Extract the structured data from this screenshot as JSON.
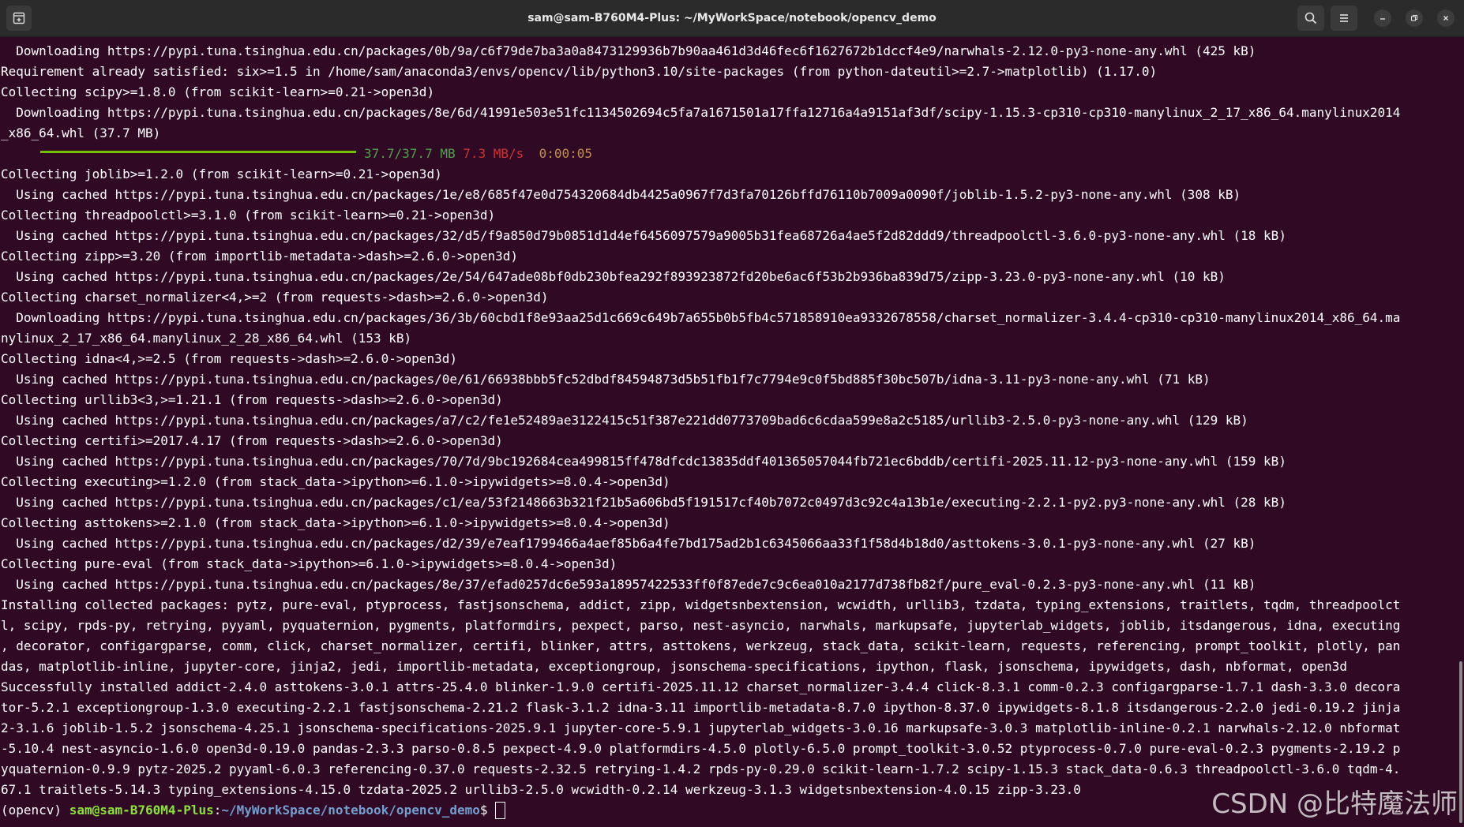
{
  "window": {
    "title": "sam@sam-B760M4-Plus: ~/MyWorkSpace/notebook/opencv_demo"
  },
  "titlebar_icons": {
    "new_tab": "new-tab-icon",
    "search": "search-icon",
    "menu": "hamburger-menu-icon",
    "minimize": "minimize-icon",
    "restore": "restore-icon",
    "close": "close-icon"
  },
  "colors": {
    "background": "#300a24",
    "text": "#ffffff",
    "progress_green": "#73c000",
    "prompt_user": "#8ae234",
    "prompt_path": "#729fcf"
  },
  "terminal": {
    "lines": [
      "  Downloading https://pypi.tuna.tsinghua.edu.cn/packages/0b/9a/c6f79de7ba3a0a8473129936b7b90aa461d3d46fec6f1627672b1dccf4e9/narwhals-2.12.0-py3-none-any.whl (425 kB)",
      "Requirement already satisfied: six>=1.5 in /home/sam/anaconda3/envs/opencv/lib/python3.10/site-packages (from python-dateutil>=2.7->matplotlib) (1.17.0)",
      "Collecting scipy>=1.8.0 (from scikit-learn>=0.21->open3d)",
      "  Downloading https://pypi.tuna.tsinghua.edu.cn/packages/8e/6d/41991e503e51fc1134502694c5fa7a1671501a17ffa12716a4a9151af3df/scipy-1.15.3-cp310-cp310-manylinux_2_17_x86_64.manylinux2014",
      "_x86_64.whl (37.7 MB)"
    ],
    "progress": {
      "done": "37.7/37.7 MB",
      "speed": "7.3 MB/s",
      "eta": "0:00:05",
      "fraction": 1.0
    },
    "lines2": [
      "Collecting joblib>=1.2.0 (from scikit-learn>=0.21->open3d)",
      "  Using cached https://pypi.tuna.tsinghua.edu.cn/packages/1e/e8/685f47e0d754320684db4425a0967f7d3fa70126bffd76110b7009a0090f/joblib-1.5.2-py3-none-any.whl (308 kB)",
      "Collecting threadpoolctl>=3.1.0 (from scikit-learn>=0.21->open3d)",
      "  Using cached https://pypi.tuna.tsinghua.edu.cn/packages/32/d5/f9a850d79b0851d1d4ef6456097579a9005b31fea68726a4ae5f2d82ddd9/threadpoolctl-3.6.0-py3-none-any.whl (18 kB)",
      "Collecting zipp>=3.20 (from importlib-metadata->dash>=2.6.0->open3d)",
      "  Using cached https://pypi.tuna.tsinghua.edu.cn/packages/2e/54/647ade08bf0db230bfea292f893923872fd20be6ac6f53b2b936ba839d75/zipp-3.23.0-py3-none-any.whl (10 kB)",
      "Collecting charset_normalizer<4,>=2 (from requests->dash>=2.6.0->open3d)",
      "  Downloading https://pypi.tuna.tsinghua.edu.cn/packages/36/3b/60cbd1f8e93aa25d1c669c649b7a655b0b5fb4c571858910ea9332678558/charset_normalizer-3.4.4-cp310-cp310-manylinux2014_x86_64.ma",
      "nylinux_2_17_x86_64.manylinux_2_28_x86_64.whl (153 kB)",
      "Collecting idna<4,>=2.5 (from requests->dash>=2.6.0->open3d)",
      "  Using cached https://pypi.tuna.tsinghua.edu.cn/packages/0e/61/66938bbb5fc52dbdf84594873d5b51fb1f7c7794e9c0f5bd885f30bc507b/idna-3.11-py3-none-any.whl (71 kB)",
      "Collecting urllib3<3,>=1.21.1 (from requests->dash>=2.6.0->open3d)",
      "  Using cached https://pypi.tuna.tsinghua.edu.cn/packages/a7/c2/fe1e52489ae3122415c51f387e221dd0773709bad6c6cdaa599e8a2c5185/urllib3-2.5.0-py3-none-any.whl (129 kB)",
      "Collecting certifi>=2017.4.17 (from requests->dash>=2.6.0->open3d)",
      "  Using cached https://pypi.tuna.tsinghua.edu.cn/packages/70/7d/9bc192684cea499815ff478dfcdc13835ddf401365057044fb721ec6bddb/certifi-2025.11.12-py3-none-any.whl (159 kB)",
      "Collecting executing>=1.2.0 (from stack_data->ipython>=6.1.0->ipywidgets>=8.0.4->open3d)",
      "  Using cached https://pypi.tuna.tsinghua.edu.cn/packages/c1/ea/53f2148663b321f21b5a606bd5f191517cf40b7072c0497d3c92c4a13b1e/executing-2.2.1-py2.py3-none-any.whl (28 kB)",
      "Collecting asttokens>=2.1.0 (from stack_data->ipython>=6.1.0->ipywidgets>=8.0.4->open3d)",
      "  Using cached https://pypi.tuna.tsinghua.edu.cn/packages/d2/39/e7eaf1799466a4aef85b6a4fe7bd175ad2b1c6345066aa33f1f58d4b18d0/asttokens-3.0.1-py3-none-any.whl (27 kB)",
      "Collecting pure-eval (from stack_data->ipython>=6.1.0->ipywidgets>=8.0.4->open3d)",
      "  Using cached https://pypi.tuna.tsinghua.edu.cn/packages/8e/37/efad0257dc6e593a18957422533ff0f87ede7c9c6ea010a2177d738fb82f/pure_eval-0.2.3-py3-none-any.whl (11 kB)",
      "Installing collected packages: pytz, pure-eval, ptyprocess, fastjsonschema, addict, zipp, widgetsnbextension, wcwidth, urllib3, tzdata, typing_extensions, traitlets, tqdm, threadpoolct",
      "l, scipy, rpds-py, retrying, pyyaml, pyquaternion, pygments, platformdirs, pexpect, parso, nest-asyncio, narwhals, markupsafe, jupyterlab_widgets, joblib, itsdangerous, idna, executing",
      ", decorator, configargparse, comm, click, charset_normalizer, certifi, blinker, attrs, asttokens, werkzeug, stack_data, scikit-learn, requests, referencing, prompt_toolkit, plotly, pan",
      "das, matplotlib-inline, jupyter-core, jinja2, jedi, importlib-metadata, exceptiongroup, jsonschema-specifications, ipython, flask, jsonschema, ipywidgets, dash, nbformat, open3d",
      "Successfully installed addict-2.4.0 asttokens-3.0.1 attrs-25.4.0 blinker-1.9.0 certifi-2025.11.12 charset_normalizer-3.4.4 click-8.3.1 comm-0.2.3 configargparse-1.7.1 dash-3.3.0 decora",
      "tor-5.2.1 exceptiongroup-1.3.0 executing-2.2.1 fastjsonschema-2.21.2 flask-3.1.2 idna-3.11 importlib-metadata-8.7.0 ipython-8.37.0 ipywidgets-8.1.8 itsdangerous-2.2.0 jedi-0.19.2 jinja",
      "2-3.1.6 joblib-1.5.2 jsonschema-4.25.1 jsonschema-specifications-2025.9.1 jupyter-core-5.9.1 jupyterlab_widgets-3.0.16 markupsafe-3.0.3 matplotlib-inline-0.2.1 narwhals-2.12.0 nbformat",
      "-5.10.4 nest-asyncio-1.6.0 open3d-0.19.0 pandas-2.3.3 parso-0.8.5 pexpect-4.9.0 platformdirs-4.5.0 plotly-6.5.0 prompt_toolkit-3.0.52 ptyprocess-0.7.0 pure-eval-0.2.3 pygments-2.19.2 p",
      "yquaternion-0.9.9 pytz-2025.2 pyyaml-6.0.3 referencing-0.37.0 requests-2.32.5 retrying-1.4.2 rpds-py-0.29.0 scikit-learn-1.7.2 scipy-1.15.3 stack_data-0.6.3 threadpoolctl-3.6.0 tqdm-4.",
      "67.1 traitlets-5.14.3 typing_extensions-4.15.0 tzdata-2025.2 urllib3-2.5.0 wcwidth-0.2.14 werkzeug-3.1.3 widgetsnbextension-4.0.15 zipp-3.23.0"
    ],
    "prompt": {
      "env": "(opencv) ",
      "user": "sam@sam-B760M4-Plus",
      "sep": ":",
      "path": "~/MyWorkSpace/notebook/opencv_demo",
      "symbol": "$ "
    }
  },
  "watermark": "CSDN @比特魔法师"
}
